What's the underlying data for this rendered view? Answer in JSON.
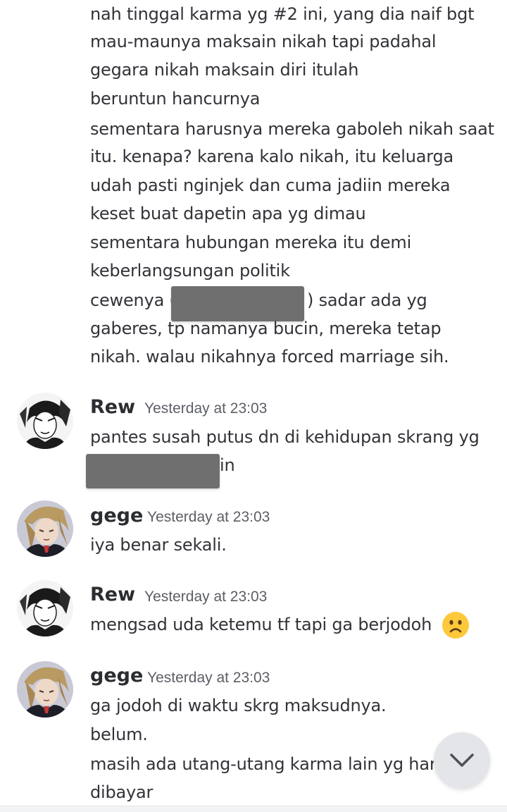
{
  "continuation": {
    "lines": [
      "nah tinggal karma yg #2 ini, yang dia naif bgt",
      "mau-maunya maksain nikah tapi padahal",
      "gegara nikah maksain diri itulah",
      "beruntun hancurnya",
      "sementara harusnya mereka gaboleh nikah saat",
      "itu. kenapa? karena kalo nikah, itu keluarga",
      "udah pasti nginjek dan cuma jadiin mereka",
      "keset buat dapetin apa yg dimau",
      "sementara hubungan mereka itu demi",
      "keberlangsungan politik",
      "cewenya (",
      ") sadar ada yg",
      "gaberes, tp namanya bucin, mereka tetap",
      "nikah. walau nikahnya forced marriage sih."
    ]
  },
  "messages": [
    {
      "author": "Rew",
      "timestamp": "Yesterday at 23:03",
      "lines": [
        "pantes susah putus dn di kehidupan skrang yg",
        "in"
      ]
    },
    {
      "author": "gege",
      "timestamp": "Yesterday at 23:03",
      "lines": [
        "iya benar sekali."
      ]
    },
    {
      "author": "Rew",
      "timestamp": "Yesterday at 23:03",
      "lines": [
        "mengsad uda ketemu tf tapi ga berjodoh"
      ],
      "emoji": "frowning-face-emoji"
    },
    {
      "author": "gege",
      "timestamp": "Yesterday at 23:03",
      "lines": [
        "ga jodoh di waktu skrg maksudnya.",
        "belum.",
        "masih ada utang-utang karma lain yg har",
        "dibayar"
      ]
    }
  ],
  "icons": {
    "scroll_down": "chevron-down-icon"
  },
  "colors": {
    "redaction": "#6f6f70",
    "scroll_button": "#e3e5e8",
    "timestamp": "#5c5e66"
  }
}
